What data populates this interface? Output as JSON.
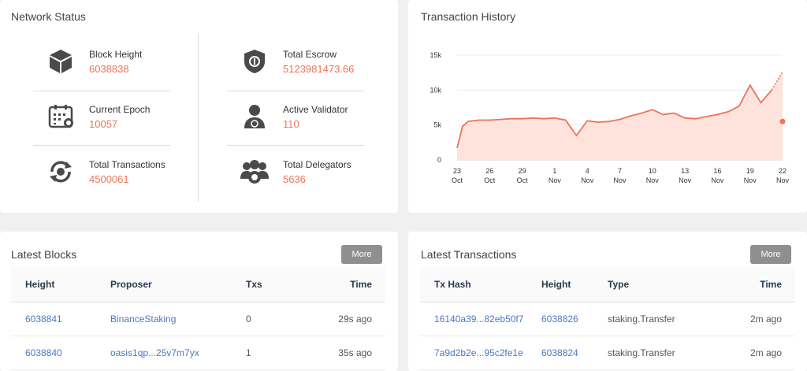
{
  "network_status": {
    "title": "Network Status",
    "stats": [
      {
        "label": "Block Height",
        "value": "6038838",
        "icon": "cube-icon"
      },
      {
        "label": "Current Epoch",
        "value": "10057",
        "icon": "calendar-icon"
      },
      {
        "label": "Total Transactions",
        "value": "4500061",
        "icon": "refresh-coin-icon"
      },
      {
        "label": "Total Escrow",
        "value": "5123981473.66",
        "icon": "shield-coin-icon"
      },
      {
        "label": "Active Validator",
        "value": "110",
        "icon": "user-badge-icon"
      },
      {
        "label": "Total Delegators",
        "value": "5636",
        "icon": "group-icon"
      }
    ]
  },
  "transaction_history": {
    "title": "Transaction History"
  },
  "chart_data": {
    "type": "area",
    "title": "Transaction History",
    "x_labels": [
      [
        "23",
        "Oct"
      ],
      [
        "26",
        "Oct"
      ],
      [
        "29",
        "Oct"
      ],
      [
        "1",
        "Nov"
      ],
      [
        "4",
        "Nov"
      ],
      [
        "7",
        "Nov"
      ],
      [
        "10",
        "Nov"
      ],
      [
        "13",
        "Nov"
      ],
      [
        "16",
        "Nov"
      ],
      [
        "19",
        "Nov"
      ],
      [
        "22",
        "Nov"
      ]
    ],
    "y_ticks": [
      "0",
      "5k",
      "10k",
      "15k"
    ],
    "ylim": [
      0,
      15000
    ],
    "series": [
      {
        "x": [
          0,
          0.5,
          1,
          2,
          3,
          4,
          5,
          6,
          7,
          8,
          9,
          10,
          11,
          12,
          13,
          14,
          15,
          16,
          17,
          18,
          19,
          20,
          21,
          22,
          23,
          24,
          25,
          26,
          27,
          28,
          29,
          30
        ],
        "values": [
          1700,
          4800,
          5500,
          5700,
          5700,
          5800,
          5900,
          5900,
          6000,
          5900,
          6000,
          5700,
          3500,
          5600,
          5400,
          5500,
          5800,
          6300,
          6700,
          7200,
          6500,
          6700,
          6000,
          5900,
          6200,
          6500,
          6900,
          7700,
          10700,
          8200,
          10000,
          12600
        ]
      }
    ],
    "accent_color": "#ee7357",
    "fill_color": "#fde3dc"
  },
  "latest_blocks": {
    "title": "Latest Blocks",
    "more_label": "More",
    "columns": [
      "Height",
      "Proposer",
      "Txs",
      "Time"
    ],
    "rows": [
      {
        "height": "6038841",
        "proposer": "BinanceStaking",
        "txs": "0",
        "time": "29s ago"
      },
      {
        "height": "6038840",
        "proposer": "oasis1qp...25v7m7yx",
        "txs": "1",
        "time": "35s ago"
      }
    ]
  },
  "latest_transactions": {
    "title": "Latest Transactions",
    "more_label": "More",
    "columns": [
      "Tx Hash",
      "Height",
      "Type",
      "Time"
    ],
    "rows": [
      {
        "hash": "16140a39...82eb50f7",
        "height": "6038826",
        "type": "staking.Transfer",
        "time": "2m ago"
      },
      {
        "hash": "7a9d2b2e...95c2fe1e",
        "height": "6038824",
        "type": "staking.Transfer",
        "time": "2m ago"
      }
    ]
  }
}
